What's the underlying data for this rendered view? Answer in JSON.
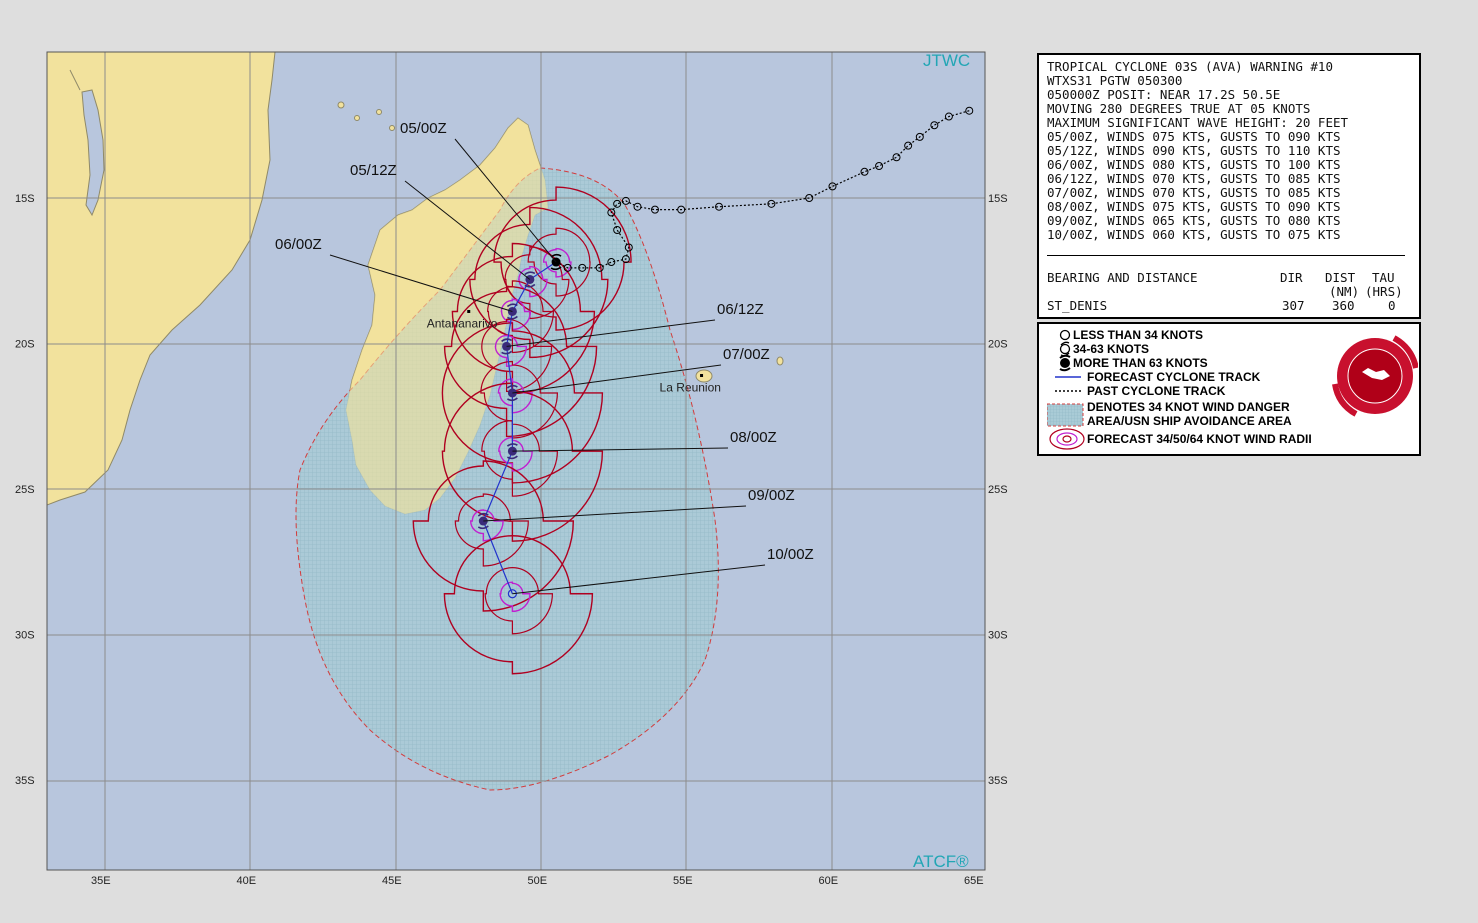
{
  "header": {
    "agency_label": "JTWC",
    "footer_label": "ATCF®"
  },
  "map": {
    "lon_ticks": [
      "35E",
      "40E",
      "45E",
      "50E",
      "55E",
      "60E",
      "65E"
    ],
    "lat_ticks": [
      "15S",
      "20S",
      "25S",
      "30S",
      "35S"
    ],
    "places": [
      {
        "name": "Antananarivo",
        "lat": -18.9,
        "lon": 47.5
      },
      {
        "name": "La Reunion",
        "lat": -21.1,
        "lon": 55.5
      }
    ],
    "forecast_points": [
      {
        "label": "05/00Z",
        "lat": -17.2,
        "lon": 50.5,
        "intensity": "more-than-63"
      },
      {
        "label": "05/12Z",
        "lat": -17.8,
        "lon": 49.6,
        "intensity": "more-than-63"
      },
      {
        "label": "06/00Z",
        "lat": -18.9,
        "lon": 49.0,
        "intensity": "more-than-63"
      },
      {
        "label": "06/12Z",
        "lat": -20.1,
        "lon": 48.8,
        "intensity": "more-than-63"
      },
      {
        "label": "07/00Z",
        "lat": -21.7,
        "lon": 49.0,
        "intensity": "more-than-63"
      },
      {
        "label": "08/00Z",
        "lat": -23.7,
        "lon": 49.0,
        "intensity": "more-than-63"
      },
      {
        "label": "09/00Z",
        "lat": -26.1,
        "lon": 48.0,
        "intensity": "more-than-63"
      },
      {
        "label": "10/00Z",
        "lat": -28.6,
        "lon": 49.0,
        "intensity": "34-63"
      }
    ],
    "past_track": [
      [
        -12.0,
        64.7
      ],
      [
        -12.2,
        64.0
      ],
      [
        -12.5,
        63.5
      ],
      [
        -12.9,
        63.0
      ],
      [
        -13.2,
        62.6
      ],
      [
        -13.6,
        62.2
      ],
      [
        -13.9,
        61.6
      ],
      [
        -14.1,
        61.1
      ],
      [
        -14.6,
        60.0
      ],
      [
        -15.0,
        59.2
      ],
      [
        -15.2,
        57.9
      ],
      [
        -15.3,
        56.1
      ],
      [
        -15.4,
        54.8
      ],
      [
        -15.4,
        53.9
      ],
      [
        -15.3,
        53.3
      ],
      [
        -15.1,
        52.9
      ],
      [
        -15.2,
        52.6
      ],
      [
        -15.5,
        52.4
      ],
      [
        -16.1,
        52.6
      ],
      [
        -16.7,
        53.0
      ],
      [
        -17.1,
        52.9
      ],
      [
        -17.2,
        52.4
      ],
      [
        -17.4,
        52.0
      ],
      [
        -17.4,
        51.4
      ],
      [
        -17.4,
        50.9
      ],
      [
        -17.2,
        50.5
      ]
    ]
  },
  "info_box": {
    "lines": [
      "TROPICAL CYCLONE 03S (AVA) WARNING #10",
      "WTXS31 PGTW 050300",
      "050000Z POSIT: NEAR 17.2S 50.5E",
      "MOVING 280 DEGREES TRUE AT 05 KNOTS",
      "MAXIMUM SIGNIFICANT WAVE HEIGHT: 20 FEET",
      "05/00Z, WINDS 075 KTS, GUSTS TO 090 KTS",
      "05/12Z, WINDS 090 KTS, GUSTS TO 110 KTS",
      "06/00Z, WINDS 080 KTS, GUSTS TO 100 KTS",
      "06/12Z, WINDS 070 KTS, GUSTS TO 085 KTS",
      "07/00Z, WINDS 070 KTS, GUSTS TO 085 KTS",
      "08/00Z, WINDS 075 KTS, GUSTS TO 090 KTS",
      "09/00Z, WINDS 065 KTS, GUSTS TO 080 KTS",
      "10/00Z, WINDS 060 KTS, GUSTS TO 075 KTS"
    ],
    "table_header_left": "BEARING AND DISTANCE",
    "table_headers": [
      "DIR",
      "DIST",
      "TAU"
    ],
    "table_units": [
      "(NM)",
      "(HRS)"
    ],
    "table_row": {
      "name": "ST_DENIS",
      "dir": "307",
      "dist": "360",
      "tau": "0"
    }
  },
  "legend": {
    "items": [
      "LESS THAN 34 KNOTS",
      "34-63 KNOTS",
      "MORE THAN 63 KNOTS",
      "FORECAST CYCLONE  TRACK",
      "PAST CYCLONE TRACK",
      "DENOTES 34 KNOT WIND DANGER",
      "AREA/USN SHIP AVOIDANCE AREA",
      "FORECAST 34/50/64 KNOT WIND RADII"
    ],
    "logo_text": [
      "JOINT TYPHOON WARNING CENTER",
      "PEARL HARBOR",
      "HAWAII"
    ]
  },
  "colors": {
    "ocean": "#b8c6dd",
    "land": "#f2e29d",
    "coast": "#8f8968",
    "grid": "#8c8c8c",
    "danger_fill": "#a8ccd8",
    "danger_edge": "#d33c3c",
    "radii": "#b00020",
    "radii_inner": "#c020d0",
    "track": "#2233cc",
    "label_cyan": "#22a6b5"
  }
}
